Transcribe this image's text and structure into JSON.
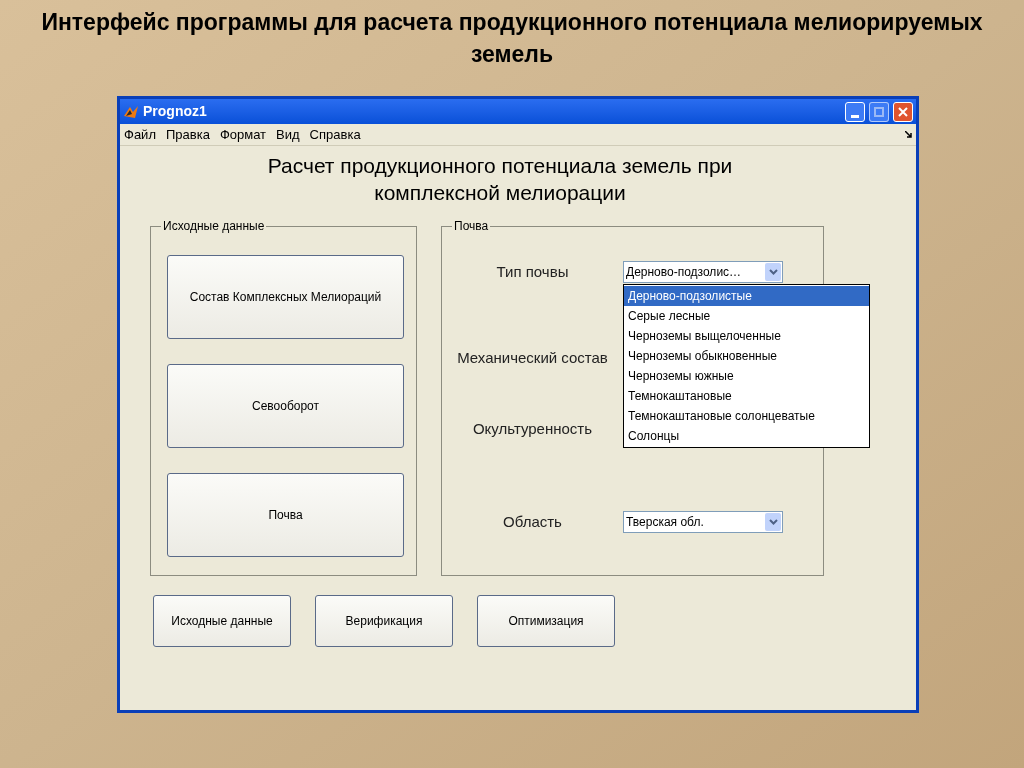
{
  "slide_title": "Интерфейс программы для расчета продукционного потенциала мелиорируемых земель",
  "window": {
    "title": "Prognoz1"
  },
  "menu": [
    "Файл",
    "Правка",
    "Формат",
    "Вид",
    "Справка"
  ],
  "heading": "Расчет продукционного потенциала земель при комплексной мелиорации",
  "input_group": {
    "title": "Исходные данные",
    "buttons": [
      "Состав Комплексных Мелиораций",
      "Севооборот",
      "Почва"
    ]
  },
  "soil_group": {
    "title": "Почва",
    "fields": [
      {
        "label": "Тип почвы",
        "value": "Дерново-подзолис…"
      },
      {
        "label": "Механический состав"
      },
      {
        "label": "Окультуренность"
      },
      {
        "label": "Область",
        "value": "Тверская обл."
      }
    ],
    "open_list": [
      {
        "label": "Дерново-подзолистые",
        "selected": true
      },
      {
        "label": "Серые лесные",
        "selected": false
      },
      {
        "label": "Черноземы выщелоченные",
        "selected": false
      },
      {
        "label": "Черноземы обыкновенные",
        "selected": false
      },
      {
        "label": "Черноземы южные",
        "selected": false
      },
      {
        "label": "Темнокаштановые",
        "selected": false
      },
      {
        "label": "Темнокаштановые солонцеватые",
        "selected": false
      },
      {
        "label": "Солонцы",
        "selected": false
      }
    ]
  },
  "bottom_buttons": [
    "Исходные данные",
    "Верификация",
    "Оптимизация"
  ]
}
